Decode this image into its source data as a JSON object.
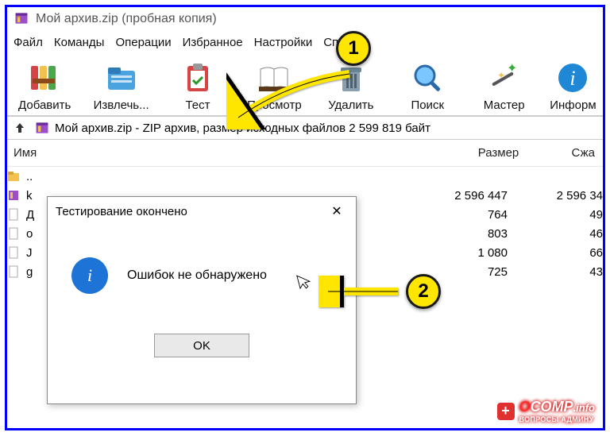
{
  "window": {
    "title": "Мой архив.zip  (пробная копия)"
  },
  "menu": {
    "file": "Файл",
    "commands": "Команды",
    "operations": "Операции",
    "favorites": "Избранное",
    "settings": "Настройки",
    "help": "Справка"
  },
  "toolbar": {
    "add": "Добавить",
    "extract": "Извлечь...",
    "test": "Тест",
    "view": "Просмотр",
    "delete": "Удалить",
    "find": "Поиск",
    "wizard": "Мастер",
    "info": "Информ"
  },
  "pathbar": {
    "text": "Мой архив.zip - ZIP архив, размер исходных файлов 2 599 819 байт"
  },
  "columns": {
    "name": "Имя",
    "size": "Размер",
    "packed": "Сжа"
  },
  "rows": [
    {
      "name": "..",
      "size": "",
      "packed": ""
    },
    {
      "name": "k",
      "size": "2 596 447",
      "packed": "2 596 34"
    },
    {
      "name": "Д",
      "size": "764",
      "packed": "49"
    },
    {
      "name": "о",
      "size": "803",
      "packed": "46"
    },
    {
      "name": "J",
      "size": "1 080",
      "packed": "66"
    },
    {
      "name": "g",
      "size": "725",
      "packed": "43"
    }
  ],
  "dialog": {
    "title": "Тестирование окончено",
    "message": "Ошибок не обнаружено",
    "ok": "OK"
  },
  "callouts": {
    "one": "1",
    "two": "2"
  },
  "watermark": {
    "brand_o": "O",
    "brand_rest": "COMP",
    "domain": ".info",
    "sub": "ВОПРОСЫ АДМИНУ"
  }
}
